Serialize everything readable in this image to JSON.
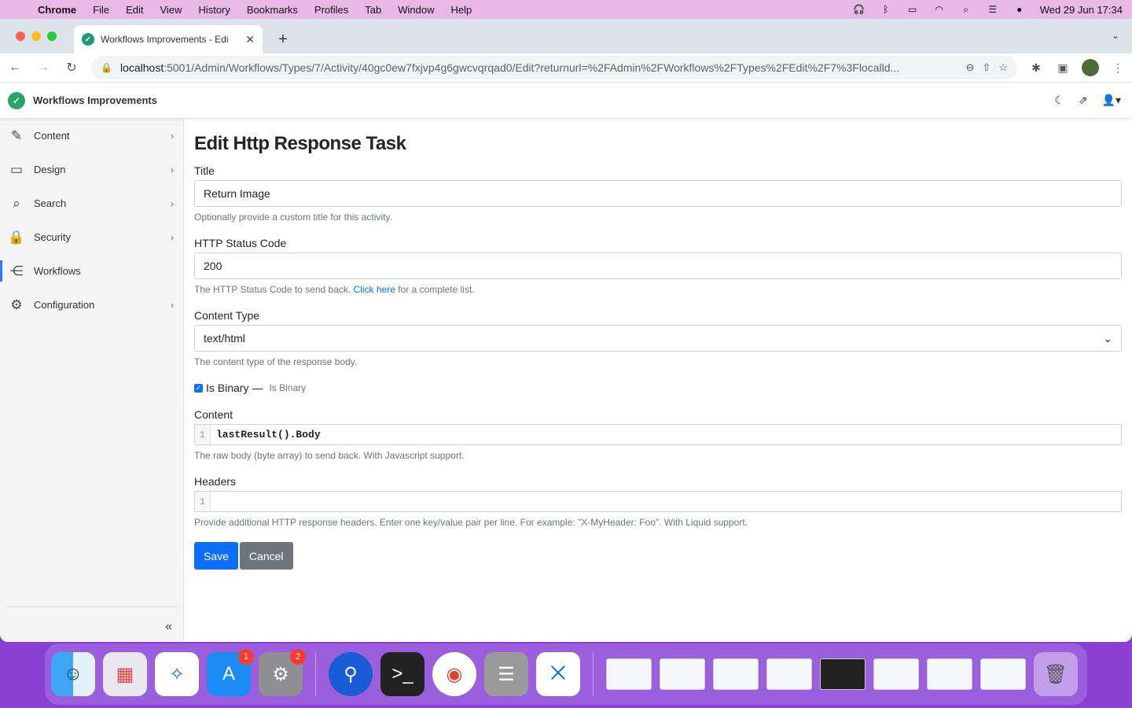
{
  "menubar": {
    "app": "Chrome",
    "items": [
      "File",
      "Edit",
      "View",
      "History",
      "Bookmarks",
      "Profiles",
      "Tab",
      "Window",
      "Help"
    ],
    "clock": "Wed 29 Jun  17:34"
  },
  "browser": {
    "tab_title": "Workflows Improvements - Edi",
    "url_host": "localhost",
    "url_path": ":5001/Admin/Workflows/Types/7/Activity/40gc0ew7fxjvp4g6gwcvqrqad0/Edit?returnurl=%2FAdmin%2FWorkflows%2FTypes%2FEdit%2F7%3Flocalld..."
  },
  "app": {
    "title": "Workflows Improvements"
  },
  "sidebar": {
    "items": [
      {
        "label": "Content"
      },
      {
        "label": "Design"
      },
      {
        "label": "Search"
      },
      {
        "label": "Security"
      },
      {
        "label": "Workflows"
      },
      {
        "label": "Configuration"
      }
    ]
  },
  "form": {
    "page_title": "Edit Http Response Task",
    "title_label": "Title",
    "title_value": "Return Image",
    "title_hint": "Optionally provide a custom title for this activity.",
    "status_label": "HTTP Status Code",
    "status_value": "200",
    "status_hint_pre": "The HTTP Status Code to send back. ",
    "status_hint_link": "Click here",
    "status_hint_post": " for a complete list.",
    "content_type_label": "Content Type",
    "content_type_value": "text/html",
    "content_type_hint": "The content type of the response body.",
    "is_binary_label": "Is Binary",
    "is_binary_sep": "—",
    "is_binary_hint": "Is Binary",
    "content_label": "Content",
    "content_line_no": "1",
    "content_code": "lastResult().Body",
    "content_hint": "The raw body (byte array) to send back. With Javascript support.",
    "headers_label": "Headers",
    "headers_line_no": "1",
    "headers_hint": "Provide additional HTTP response headers. Enter one key/value pair per line. For example: \"X-MyHeader: Foo\". With Liquid support.",
    "save_label": "Save",
    "cancel_label": "Cancel"
  },
  "dock": {
    "appstore_badge": "1",
    "settings_badge": "2"
  },
  "colors": {
    "primary": "#0d6efd",
    "secondary": "#6c757d",
    "active_nav": "#2a7cf6"
  }
}
